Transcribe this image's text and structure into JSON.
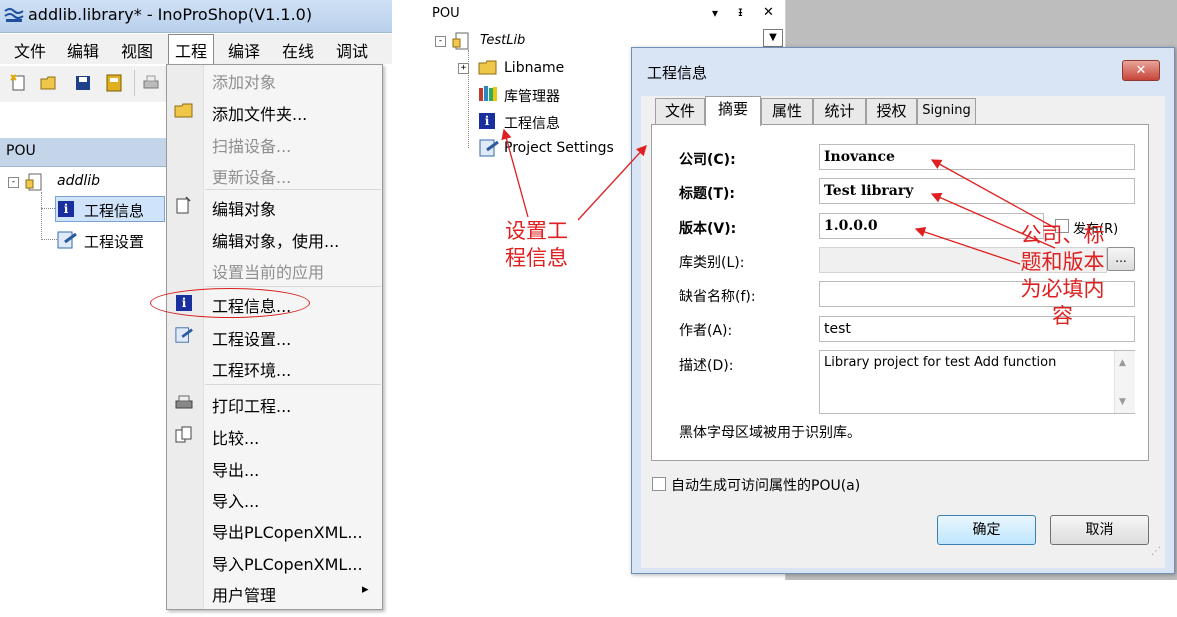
{
  "left_app": {
    "title": "addlib.library* - InoProShop(V1.1.0)",
    "menubar": [
      "文件",
      "编辑",
      "视图",
      "工程",
      "编译",
      "在线",
      "调试"
    ],
    "pou_panel_title": "POU",
    "tree": {
      "root": "addlib",
      "items": [
        "工程信息",
        "工程设置"
      ]
    },
    "project_menu": {
      "items": [
        {
          "label": "添加对象",
          "disabled": true
        },
        {
          "label": "添加文件夹...",
          "disabled": false
        },
        {
          "label": "扫描设备...",
          "disabled": true
        },
        {
          "label": "更新设备...",
          "disabled": true
        },
        {
          "label": "编辑对象",
          "disabled": false
        },
        {
          "label": "编辑对象，使用...",
          "disabled": false
        },
        {
          "label": "设置当前的应用",
          "disabled": true
        },
        {
          "label": "工程信息...",
          "disabled": false
        },
        {
          "label": "工程设置...",
          "disabled": false
        },
        {
          "label": "工程环境...",
          "disabled": false
        },
        {
          "label": "打印工程...",
          "disabled": false
        },
        {
          "label": "比较...",
          "disabled": false
        },
        {
          "label": "导出...",
          "disabled": false
        },
        {
          "label": "导入...",
          "disabled": false
        },
        {
          "label": "导出PLCopenXML...",
          "disabled": false
        },
        {
          "label": "导入PLCopenXML...",
          "disabled": false
        },
        {
          "label": "用户管理",
          "disabled": false
        }
      ],
      "submenu_arrow": "▸"
    }
  },
  "right_app": {
    "pou_panel_title": "POU",
    "pin_glyphs": {
      "dropdown": "▾",
      "pin": "ᵻ",
      "close": "✕"
    },
    "tree": {
      "root": "TestLib",
      "items": [
        "Libname",
        "库管理器",
        "工程信息",
        "Project Settings"
      ]
    },
    "dialog": {
      "title": "工程信息",
      "close_glyph": "✕",
      "tabs": [
        "文件",
        "摘要",
        "属性",
        "统计",
        "授权",
        "Signing"
      ],
      "active_tab": "摘要",
      "fields": [
        {
          "label": "公司(C):",
          "value": "Inovance",
          "bold": true
        },
        {
          "label": "标题(T):",
          "value": "Test library",
          "bold": true
        },
        {
          "label": "版本(V):",
          "value": "1.0.0.0",
          "bold": true
        },
        {
          "label": "库类别(L):",
          "value": "",
          "bold": false
        },
        {
          "label": "缺省名称(f):",
          "value": "",
          "bold": false
        },
        {
          "label": "作者(A):",
          "value": "test",
          "bold": false
        },
        {
          "label": "描述(D):",
          "value": "Library project for test Add function",
          "bold": false
        }
      ],
      "release_checkbox_label": "发布(R)",
      "category_button": "...",
      "note": "黑体字母区域被用于识别库。",
      "auto_pou_checkbox": "自动生成可访问属性的POU(a)",
      "ok_button": "确定",
      "cancel_button": "取消"
    }
  },
  "annotations": {
    "left_text_line1": "设置工",
    "left_text_line2": "程信息",
    "right_text_line1": "公司、标",
    "right_text_line2": "题和版本",
    "right_text_line3": "为必填内",
    "right_text_line4": "容"
  },
  "colors": {
    "annotation_red": "#e02020",
    "selection_blue": "#cfe3fa",
    "info_icon_blue": "#1a2f9e"
  }
}
